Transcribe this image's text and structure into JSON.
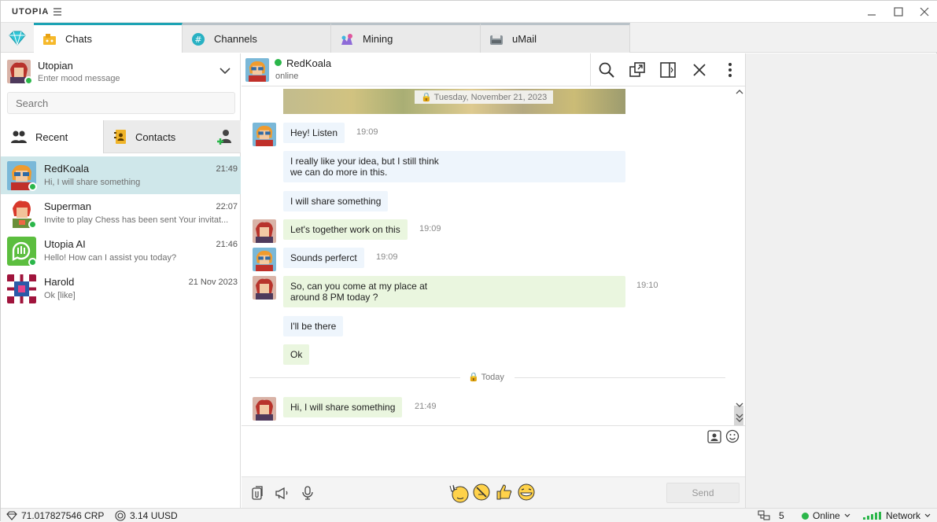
{
  "app": {
    "title": "UTOPIA"
  },
  "tabs": [
    {
      "label": "Chats",
      "active": true
    },
    {
      "label": "Channels"
    },
    {
      "label": "Mining"
    },
    {
      "label": "uMail"
    }
  ],
  "profile": {
    "name": "Utopian",
    "mood_placeholder": "Enter mood message"
  },
  "search": {
    "placeholder": "Search"
  },
  "subtabs": {
    "recent": "Recent",
    "contacts": "Contacts"
  },
  "chats": [
    {
      "name": "RedKoala",
      "preview": "Hi, I will share something",
      "time": "21:49",
      "selected": true
    },
    {
      "name": "Superman",
      "preview": "Invite to play Chess has been sent  Your invitat...",
      "time": "22:07"
    },
    {
      "name": "Utopia AI",
      "preview": "Hello! How can I assist you today?",
      "time": "21:46"
    },
    {
      "name": "Harold",
      "preview": "Ok [like]",
      "time": "21 Nov 2023"
    }
  ],
  "conversation": {
    "contact": "RedKoala",
    "status": "online",
    "date_label": "Tuesday, November 21, 2023",
    "today_label": "Today",
    "messages": [
      {
        "text": "Hey! Listen",
        "time": "19:09",
        "dir": "in"
      },
      {
        "text": "I really like your idea, but I still think\nwe can do more in this.",
        "dir": "in"
      },
      {
        "text": "I will share something",
        "dir": "in"
      },
      {
        "text": "Let's together work on this",
        "time": "19:09",
        "dir": "out"
      },
      {
        "text": "Sounds perferct",
        "time": "19:09",
        "dir": "in"
      },
      {
        "text": "So, can you come at my place at\naround 8 PM today ?",
        "time": "19:10",
        "dir": "out"
      },
      {
        "text": "I'll be there",
        "dir": "in"
      },
      {
        "text": "Ok",
        "dir": "out"
      },
      {
        "text": "Hi, I will share something",
        "time": "21:49",
        "dir": "out"
      }
    ]
  },
  "compose": {
    "send_label": "Send"
  },
  "statusbar": {
    "crp": "71.017827546 CRP",
    "uusd": "3.14 UUSD",
    "peers": "5",
    "online": "Online",
    "network": "Network"
  },
  "colors": {
    "accent": "#1ca3b4",
    "online": "#2bb64a",
    "incoming_bubble": "#eef5fc",
    "outgoing_bubble": "#eaf6df",
    "selected_row": "#cfe7ea"
  }
}
